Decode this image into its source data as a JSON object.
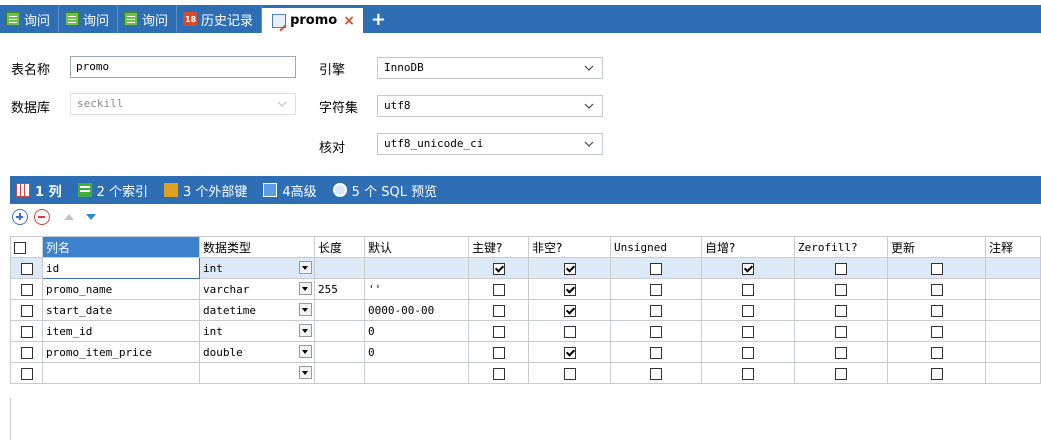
{
  "tabs": [
    {
      "label": "询问",
      "icon": "query-icon"
    },
    {
      "label": "询问",
      "icon": "query-icon"
    },
    {
      "label": "询问",
      "icon": "query-icon"
    },
    {
      "label": "历史记录",
      "icon": "history-icon",
      "icon_text": "18"
    },
    {
      "label": "promo",
      "icon": "table-design-icon",
      "active": true
    }
  ],
  "tab_close": "×",
  "tab_add": "+",
  "form": {
    "table_name_label": "表名称",
    "table_name_value": "promo",
    "database_label": "数据库",
    "database_value": "seckill",
    "engine_label": "引擎",
    "engine_value": "InnoDB",
    "charset_label": "字符集",
    "charset_value": "utf8",
    "collation_label": "核对",
    "collation_value": "utf8_unicode_ci"
  },
  "subtabs": [
    {
      "label": "1 列",
      "icon": "columns-icon",
      "active": true
    },
    {
      "label": "2 个索引",
      "icon": "index-icon"
    },
    {
      "label": "3 个外部键",
      "icon": "foreign-key-icon"
    },
    {
      "label": "4高级",
      "icon": "advanced-icon"
    },
    {
      "label": "5 个 SQL 预览",
      "icon": "sql-preview-icon"
    }
  ],
  "grid": {
    "headers": [
      "列名",
      "数据类型",
      "长度",
      "默认",
      "主键?",
      "非空?",
      "Unsigned",
      "自增?",
      "Zerofill?",
      "更新",
      "注释"
    ],
    "rows": [
      {
        "name": "id",
        "type": "int",
        "length": "",
        "default": "",
        "pk": true,
        "notnull": true,
        "unsigned": false,
        "ai": true,
        "zerofill": false,
        "update": false,
        "selected": true
      },
      {
        "name": "promo_name",
        "type": "varchar",
        "length": "255",
        "default": "''",
        "pk": false,
        "notnull": true,
        "unsigned": false,
        "ai": false,
        "zerofill": false,
        "update": false
      },
      {
        "name": "start_date",
        "type": "datetime",
        "length": "",
        "default": "0000-00-00",
        "pk": false,
        "notnull": true,
        "unsigned": false,
        "ai": false,
        "zerofill": false,
        "update": false
      },
      {
        "name": "item_id",
        "type": "int",
        "length": "",
        "default": "0",
        "pk": false,
        "notnull": false,
        "unsigned": false,
        "ai": false,
        "zerofill": false,
        "update": false
      },
      {
        "name": "promo_item_price",
        "type": "double",
        "length": "",
        "default": "0",
        "pk": false,
        "notnull": true,
        "unsigned": false,
        "ai": false,
        "zerofill": false,
        "update": false
      },
      {
        "name": "",
        "type": "",
        "length": "",
        "default": "",
        "pk": false,
        "notnull": false,
        "unsigned": false,
        "ai": false,
        "zerofill": false,
        "update": false
      }
    ]
  },
  "colors": {
    "tabbar": "#2d6eb4",
    "header_selected": "#3c82cc",
    "selection": "#dde9f7"
  }
}
